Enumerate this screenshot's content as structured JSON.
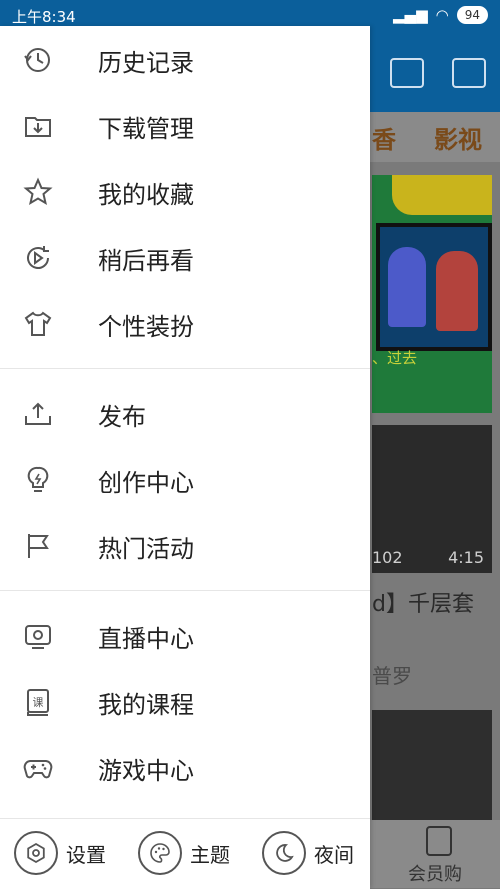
{
  "status_bar": {
    "time": "上午8:34",
    "battery": "94"
  },
  "drawer": {
    "section1": [
      {
        "label": "历史记录",
        "icon": "history-icon"
      },
      {
        "label": "下载管理",
        "icon": "download-folder-icon"
      },
      {
        "label": "我的收藏",
        "icon": "star-icon"
      },
      {
        "label": "稍后再看",
        "icon": "watch-later-icon"
      },
      {
        "label": "个性装扮",
        "icon": "shirt-icon"
      }
    ],
    "section2": [
      {
        "label": "发布",
        "icon": "upload-icon"
      },
      {
        "label": "创作中心",
        "icon": "lightbulb-icon"
      },
      {
        "label": "热门活动",
        "icon": "flag-icon"
      }
    ],
    "section3": [
      {
        "label": "直播中心",
        "icon": "tv-icon"
      },
      {
        "label": "我的课程",
        "icon": "course-book-icon"
      },
      {
        "label": "游戏中心",
        "icon": "gamepad-icon"
      }
    ],
    "bottom": {
      "settings": "设置",
      "theme": "主题",
      "night": "夜间"
    }
  },
  "background": {
    "tab_fragment": "香",
    "tab_label": "影视",
    "video_caption": "、过去",
    "video2_views": "102",
    "video2_duration": "4:15",
    "video2_title": "d】千层套",
    "video2_author": "普罗",
    "nav_member": "会员购"
  }
}
